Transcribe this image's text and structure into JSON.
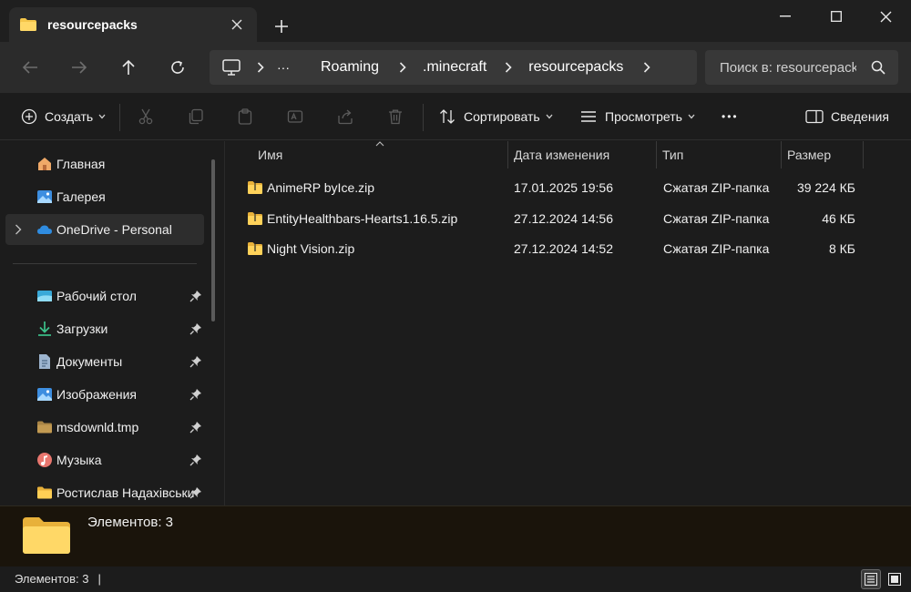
{
  "window": {
    "tab_title": "resourcepacks",
    "new_tab_label": "+"
  },
  "address": {
    "ellipsis": "···",
    "crumbs": [
      "Roaming",
      ".minecraft",
      "resourcepacks"
    ]
  },
  "search": {
    "placeholder": "Поиск в: resourcepacks"
  },
  "toolbar": {
    "create_label": "Создать",
    "sort_label": "Сортировать",
    "view_label": "Просмотреть",
    "more_label": "•••",
    "details_label": "Сведения"
  },
  "sidebar": {
    "items": [
      {
        "label": "Главная",
        "icon": "home-icon"
      },
      {
        "label": "Галерея",
        "icon": "gallery-icon"
      },
      {
        "label": "OneDrive - Personal",
        "icon": "cloud-icon"
      }
    ],
    "pinned": [
      {
        "label": "Рабочий стол",
        "icon": "desktop-icon"
      },
      {
        "label": "Загрузки",
        "icon": "download-icon"
      },
      {
        "label": "Документы",
        "icon": "document-icon"
      },
      {
        "label": "Изображения",
        "icon": "image-icon"
      },
      {
        "label": "msdownld.tmp",
        "icon": "folder-icon"
      },
      {
        "label": "Музыка",
        "icon": "music-icon"
      },
      {
        "label": "Ростислав Надахівськи",
        "icon": "folder-icon"
      }
    ]
  },
  "columns": {
    "name": "Имя",
    "date": "Дата изменения",
    "type": "Тип",
    "size": "Размер"
  },
  "files": [
    {
      "name": "AnimeRP byIce.zip",
      "date": "17.01.2025 19:56",
      "type": "Сжатая ZIP-папка",
      "size": "39 224 КБ"
    },
    {
      "name": "EntityHealthbars-Hearts1.16.5.zip",
      "date": "27.12.2024 14:56",
      "type": "Сжатая ZIP-папка",
      "size": "46 КБ"
    },
    {
      "name": "Night Vision.zip",
      "date": "27.12.2024 14:52",
      "type": "Сжатая ZIP-папка",
      "size": "8 КБ"
    }
  ],
  "details": {
    "count_text": "Элементов: 3"
  },
  "status": {
    "count_text": "Элементов: 3",
    "cursor": "|"
  }
}
